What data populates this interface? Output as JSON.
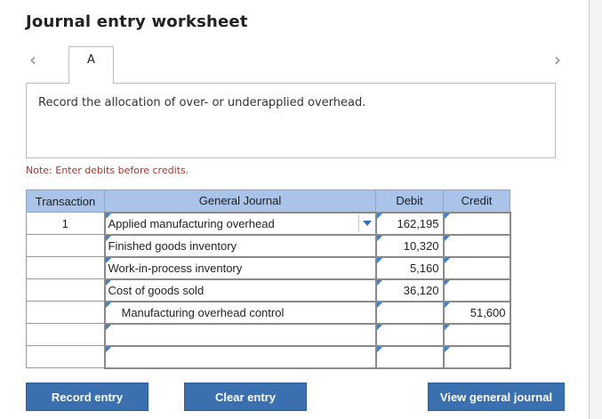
{
  "worksheet": {
    "title": "Journal entry worksheet",
    "prev_icon": "chevron-left-icon",
    "next_icon": "chevron-right-icon",
    "tabs": [
      {
        "label": "A",
        "active": true
      }
    ],
    "prompt": "Record the allocation of over- or underapplied overhead.",
    "note": "Note: Enter debits before credits."
  },
  "journal": {
    "headers": {
      "transaction": "Transaction",
      "general_journal": "General Journal",
      "debit": "Debit",
      "credit": "Credit"
    },
    "rows": [
      {
        "transaction": "1",
        "account": "Applied manufacturing overhead",
        "debit": "162,195",
        "credit": "",
        "indent": false,
        "has_dropdown": true
      },
      {
        "transaction": "",
        "account": "Finished goods inventory",
        "debit": "10,320",
        "credit": "",
        "indent": false,
        "has_dropdown": false
      },
      {
        "transaction": "",
        "account": "Work-in-process inventory",
        "debit": "5,160",
        "credit": "",
        "indent": false,
        "has_dropdown": false
      },
      {
        "transaction": "",
        "account": "Cost of goods sold",
        "debit": "36,120",
        "credit": "",
        "indent": false,
        "has_dropdown": false
      },
      {
        "transaction": "",
        "account": "Manufacturing overhead control",
        "debit": "",
        "credit": "51,600",
        "indent": true,
        "has_dropdown": false
      },
      {
        "transaction": "",
        "account": "",
        "debit": "",
        "credit": "",
        "indent": false,
        "has_dropdown": false
      },
      {
        "transaction": "",
        "account": "",
        "debit": "",
        "credit": "",
        "indent": false,
        "has_dropdown": false
      }
    ]
  },
  "buttons": {
    "record": "Record entry",
    "clear": "Clear entry",
    "view": "View general journal"
  },
  "colors": {
    "header_bg": "#a9c4e8",
    "button_bg": "#3a6fb0",
    "note_text": "#b0352a",
    "marker": "#3a7fd0"
  }
}
